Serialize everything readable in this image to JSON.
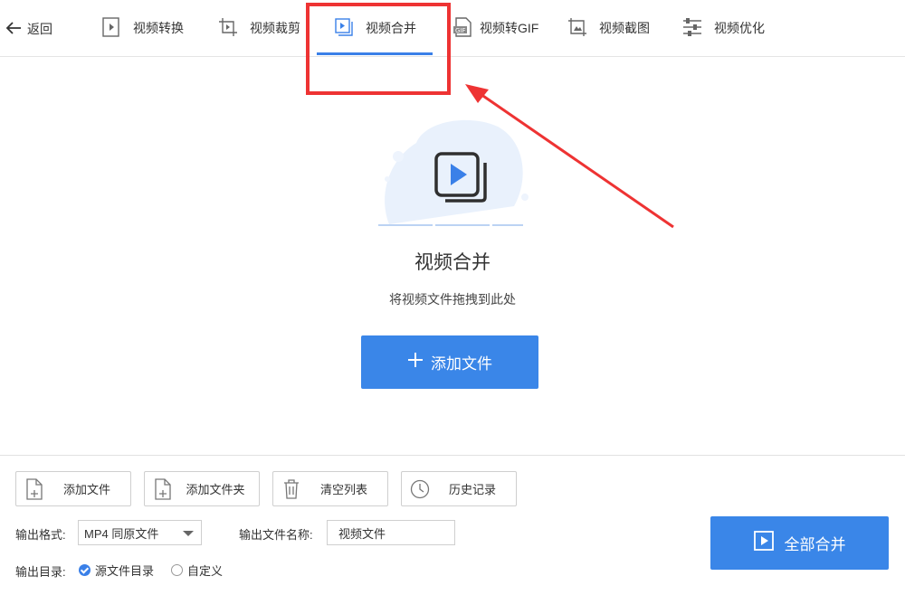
{
  "nav": {
    "back_label": "返回",
    "tabs": [
      {
        "label": "视频转换",
        "icon": "video-convert-icon"
      },
      {
        "label": "视频裁剪",
        "icon": "video-crop-icon"
      },
      {
        "label": "视频合并",
        "icon": "video-merge-icon",
        "active": true
      },
      {
        "label": "视频转GIF",
        "icon": "gif-icon"
      },
      {
        "label": "视频截图",
        "icon": "screenshot-icon"
      },
      {
        "label": "视频优化",
        "icon": "sliders-icon"
      }
    ]
  },
  "main": {
    "title": "视频合并",
    "subtitle": "将视频文件拖拽到此处",
    "add_button": "添加文件"
  },
  "toolbar": {
    "add_file": "添加文件",
    "add_folder": "添加文件夹",
    "clear_list": "清空列表",
    "history": "历史记录"
  },
  "output": {
    "format_label": "输出格式:",
    "format_value": "MP4 同原文件",
    "filename_label": "输出文件名称:",
    "filename_value": "视频文件",
    "dir_label": "输出目录:",
    "dir_options": [
      "源文件目录",
      "自定义"
    ],
    "dir_selected": "源文件目录"
  },
  "merge_all_button": "全部合并",
  "colors": {
    "accent": "#3a86e8",
    "highlight": "#ee3333"
  }
}
